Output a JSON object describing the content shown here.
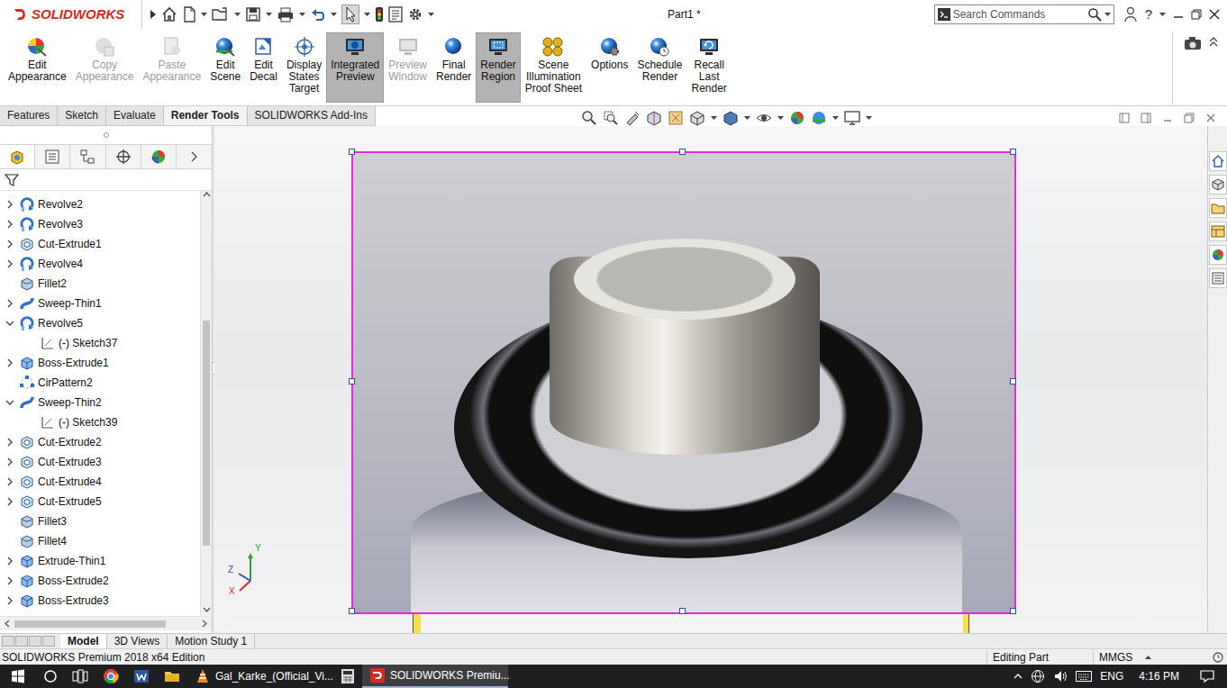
{
  "window": {
    "app": "SOLIDWORKS",
    "title": "Part1 *"
  },
  "search": {
    "placeholder": "Search Commands"
  },
  "help": "?",
  "ribbon": [
    {
      "lines": [
        "Edit",
        "Appearance"
      ],
      "disabled": false,
      "selected": false
    },
    {
      "lines": [
        "Copy",
        "Appearance"
      ],
      "disabled": true,
      "selected": false
    },
    {
      "lines": [
        "Paste",
        "Appearance"
      ],
      "disabled": true,
      "selected": false
    },
    {
      "lines": [
        "Edit",
        "Scene"
      ],
      "disabled": false,
      "selected": false
    },
    {
      "lines": [
        "Edit",
        "Decal"
      ],
      "disabled": false,
      "selected": false
    },
    {
      "lines": [
        "Display",
        "States",
        "Target"
      ],
      "disabled": false,
      "selected": false
    },
    {
      "lines": [
        "Integrated",
        "Preview"
      ],
      "disabled": false,
      "selected": true
    },
    {
      "lines": [
        "Preview",
        "Window"
      ],
      "disabled": true,
      "selected": false
    },
    {
      "lines": [
        "Final",
        "Render"
      ],
      "disabled": false,
      "selected": false
    },
    {
      "lines": [
        "Render",
        "Region"
      ],
      "disabled": false,
      "selected": true
    },
    {
      "lines": [
        "Scene",
        "Illumination",
        "Proof Sheet"
      ],
      "disabled": false,
      "selected": false
    },
    {
      "lines": [
        "Options"
      ],
      "disabled": false,
      "selected": false
    },
    {
      "lines": [
        "Schedule",
        "Render"
      ],
      "disabled": false,
      "selected": false
    },
    {
      "lines": [
        "Recall",
        "Last",
        "Render"
      ],
      "disabled": false,
      "selected": false
    }
  ],
  "tabs": [
    {
      "label": "Features",
      "selected": false
    },
    {
      "label": "Sketch",
      "selected": false
    },
    {
      "label": "Evaluate",
      "selected": false
    },
    {
      "label": "Render Tools",
      "selected": true
    },
    {
      "label": "SOLIDWORKS Add-Ins",
      "selected": false
    }
  ],
  "panel_tabs": [
    {
      "selected": true
    },
    {
      "selected": false
    },
    {
      "selected": false
    },
    {
      "selected": false
    },
    {
      "selected": false
    }
  ],
  "tree": [
    {
      "label": "Revolve2",
      "kind": "feature",
      "expander": "closed"
    },
    {
      "label": "Revolve3",
      "kind": "feature",
      "expander": "closed"
    },
    {
      "label": "Cut-Extrude1",
      "kind": "feature",
      "expander": "closed"
    },
    {
      "label": "Revolve4",
      "kind": "feature",
      "expander": "closed"
    },
    {
      "label": "Fillet2",
      "kind": "feature",
      "expander": "none"
    },
    {
      "label": "Sweep-Thin1",
      "kind": "feature",
      "expander": "closed"
    },
    {
      "label": "Revolve5",
      "kind": "feature",
      "expander": "open"
    },
    {
      "label": "(-) Sketch37",
      "kind": "child",
      "expander": "none"
    },
    {
      "label": "Boss-Extrude1",
      "kind": "feature",
      "expander": "closed"
    },
    {
      "label": "CirPattern2",
      "kind": "feature",
      "expander": "none"
    },
    {
      "label": "Sweep-Thin2",
      "kind": "feature",
      "expander": "open"
    },
    {
      "label": "(-) Sketch39",
      "kind": "child",
      "expander": "none"
    },
    {
      "label": "Cut-Extrude2",
      "kind": "feature",
      "expander": "closed"
    },
    {
      "label": "Cut-Extrude3",
      "kind": "feature",
      "expander": "closed"
    },
    {
      "label": "Cut-Extrude4",
      "kind": "feature",
      "expander": "closed"
    },
    {
      "label": "Cut-Extrude5",
      "kind": "feature",
      "expander": "closed"
    },
    {
      "label": "Fillet3",
      "kind": "feature",
      "expander": "none"
    },
    {
      "label": "Fillet4",
      "kind": "feature",
      "expander": "none"
    },
    {
      "label": "Extrude-Thin1",
      "kind": "feature",
      "expander": "closed"
    },
    {
      "label": "Boss-Extrude2",
      "kind": "feature",
      "expander": "closed"
    },
    {
      "label": "Boss-Extrude3",
      "kind": "feature",
      "expander": "closed"
    }
  ],
  "triad": [
    {
      "label": "Y",
      "color": "#2e9e3a"
    },
    {
      "label": "Z",
      "color": "#2a4fc9"
    },
    {
      "label": "X",
      "color": "#d42a2a"
    }
  ],
  "bottom_tabs": [
    {
      "label": "Model",
      "selected": true
    },
    {
      "label": "3D Views",
      "selected": false
    },
    {
      "label": "Motion Study 1",
      "selected": false
    }
  ],
  "status_bar": {
    "edition": "SOLIDWORKS Premium 2018 x64 Edition",
    "mode": "Editing Part",
    "units": "MMGS"
  },
  "taskbar": {
    "apps": [
      {
        "kind": "start",
        "label": "",
        "selected": false
      },
      {
        "kind": "search",
        "label": "",
        "selected": false
      },
      {
        "kind": "taskview",
        "label": "",
        "selected": false
      },
      {
        "kind": "chrome",
        "label": "",
        "selected": false
      },
      {
        "kind": "word",
        "label": "",
        "selected": false
      },
      {
        "kind": "explorer",
        "label": "",
        "selected": false
      },
      {
        "kind": "vlc",
        "label": "Gal_Karke_(Official_Vi...",
        "selected": false
      },
      {
        "kind": "calculator",
        "label": "",
        "selected": false
      },
      {
        "kind": "solidworks",
        "label": "SOLIDWORKS Premiu...",
        "selected": true
      }
    ],
    "language": "ENG",
    "time": "4:16 PM"
  }
}
